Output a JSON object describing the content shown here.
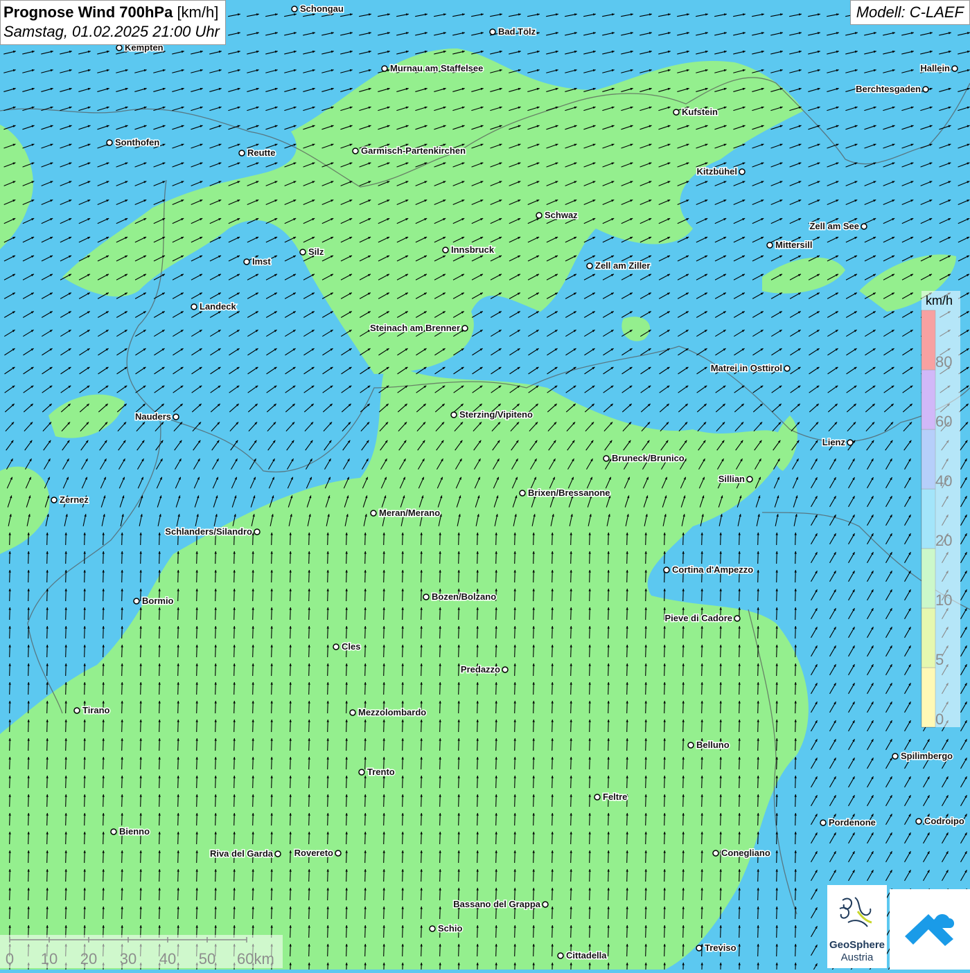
{
  "header": {
    "title": "Prognose Wind 700hPa",
    "unit": "[km/h]",
    "datetime": "Samstag, 01.02.2025 21:00 Uhr",
    "model": "Modell: C-LAEF"
  },
  "legend": {
    "unit": "km/h",
    "classes": [
      {
        "label": "0",
        "color": "#fff25e"
      },
      {
        "label": "5",
        "color": "#c8f050"
      },
      {
        "label": "10",
        "color": "#8ef08a"
      },
      {
        "label": "20",
        "color": "#34c6f4"
      },
      {
        "label": "40",
        "color": "#5e96f4"
      },
      {
        "label": "60",
        "color": "#9a62f0"
      },
      {
        "label": "80",
        "color": "#ee3030"
      }
    ]
  },
  "scale_bar": {
    "labels": [
      "0",
      "10",
      "20",
      "30",
      "40",
      "50",
      "60km"
    ]
  },
  "cities": [
    {
      "name": "Schongau",
      "label_side": "right"
    },
    {
      "name": "Bad Tölz",
      "label_side": "right"
    },
    {
      "name": "Kempten",
      "label_side": "right"
    },
    {
      "name": "Murnau am Staffelsee",
      "label_side": "right"
    },
    {
      "name": "Hallein",
      "label_side": "left"
    },
    {
      "name": "Berchtesgaden",
      "label_side": "left"
    },
    {
      "name": "Kufstein",
      "label_side": "right"
    },
    {
      "name": "Sonthofen",
      "label_side": "right"
    },
    {
      "name": "Reutte",
      "label_side": "right"
    },
    {
      "name": "Garmisch-Partenkirchen",
      "label_side": "right"
    },
    {
      "name": "Kitzbühel",
      "label_side": "left"
    },
    {
      "name": "Schwaz",
      "label_side": "right"
    },
    {
      "name": "Zell am See",
      "label_side": "left"
    },
    {
      "name": "Mittersill",
      "label_side": "right"
    },
    {
      "name": "Innsbruck",
      "label_side": "right"
    },
    {
      "name": "Imst",
      "label_side": "right"
    },
    {
      "name": "Silz",
      "label_side": "right"
    },
    {
      "name": "Zell am Ziller",
      "label_side": "right"
    },
    {
      "name": "Landeck",
      "label_side": "right"
    },
    {
      "name": "Steinach am Brenner",
      "label_side": "left"
    },
    {
      "name": "Matrei in Osttirol",
      "label_side": "left"
    },
    {
      "name": "Nauders",
      "label_side": "left"
    },
    {
      "name": "Sterzing/Vipiteno",
      "label_side": "right"
    },
    {
      "name": "Lienz",
      "label_side": "left"
    },
    {
      "name": "Bruneck/Brunico",
      "label_side": "right"
    },
    {
      "name": "Sillian",
      "label_side": "left"
    },
    {
      "name": "Zernez",
      "label_side": "right"
    },
    {
      "name": "Brixen/Bressanone",
      "label_side": "right"
    },
    {
      "name": "Meran/Merano",
      "label_side": "right"
    },
    {
      "name": "Schlanders/Silandro",
      "label_side": "left"
    },
    {
      "name": "Cortina d'Ampezzo",
      "label_side": "right"
    },
    {
      "name": "Bozen/Bolzano",
      "label_side": "right"
    },
    {
      "name": "Bormio",
      "label_side": "right"
    },
    {
      "name": "Pieve di Cadore",
      "label_side": "left"
    },
    {
      "name": "Cles",
      "label_side": "right"
    },
    {
      "name": "Predazzo",
      "label_side": "left"
    },
    {
      "name": "Tirano",
      "label_side": "right"
    },
    {
      "name": "Mezzolombardo",
      "label_side": "right"
    },
    {
      "name": "Belluno",
      "label_side": "right"
    },
    {
      "name": "Spilimbergo",
      "label_side": "right"
    },
    {
      "name": "Trento",
      "label_side": "right"
    },
    {
      "name": "Feltre",
      "label_side": "right"
    },
    {
      "name": "Pordenone",
      "label_side": "right"
    },
    {
      "name": "Codroipo",
      "label_side": "right"
    },
    {
      "name": "Bienno",
      "label_side": "right"
    },
    {
      "name": "Riva del Garda",
      "label_side": "left"
    },
    {
      "name": "Rovereto",
      "label_side": "left"
    },
    {
      "name": "Conegliano",
      "label_side": "right"
    },
    {
      "name": "Bassano del Grappa",
      "label_side": "left"
    },
    {
      "name": "Schio",
      "label_side": "right"
    },
    {
      "name": "Treviso",
      "label_side": "right"
    },
    {
      "name": "Cittadella",
      "label_side": "right"
    }
  ],
  "logos": {
    "geosphere_name": "GeoSphere",
    "geosphere_sub": "Austria"
  }
}
